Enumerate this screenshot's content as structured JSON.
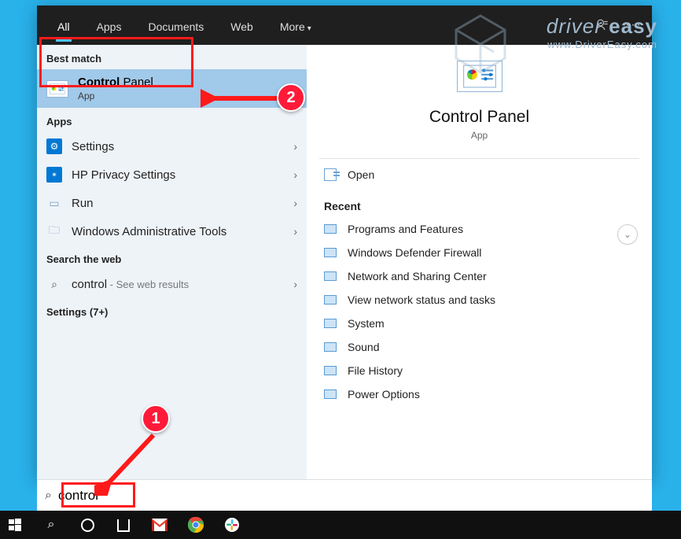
{
  "tabs": {
    "all": "All",
    "apps": "Apps",
    "documents": "Documents",
    "web": "Web",
    "more": "More"
  },
  "left": {
    "best_match_label": "Best match",
    "best": {
      "title_bold": "Control",
      "title_rest": " Panel",
      "subtitle": "App"
    },
    "apps_label": "Apps",
    "apps": [
      {
        "label": "Settings"
      },
      {
        "label": "HP Privacy Settings"
      },
      {
        "label": "Run"
      },
      {
        "label": "Windows Administrative Tools"
      }
    ],
    "search_web_label": "Search the web",
    "search_web": {
      "query": "control",
      "hint": " - See web results"
    },
    "settings_more": "Settings (7+)"
  },
  "right": {
    "title": "Control Panel",
    "subtitle": "App",
    "open": "Open",
    "recent_label": "Recent",
    "recent": [
      "Programs and Features",
      "Windows Defender Firewall",
      "Network and Sharing Center",
      "View network status and tasks",
      "System",
      "Sound",
      "File History",
      "Power Options"
    ]
  },
  "search": {
    "value": "control"
  },
  "watermark": {
    "line1a": "driver",
    "line1b": "easy",
    "line2": "www.DriverEasy.com"
  },
  "annotations": {
    "step1": "1",
    "step2": "2"
  }
}
